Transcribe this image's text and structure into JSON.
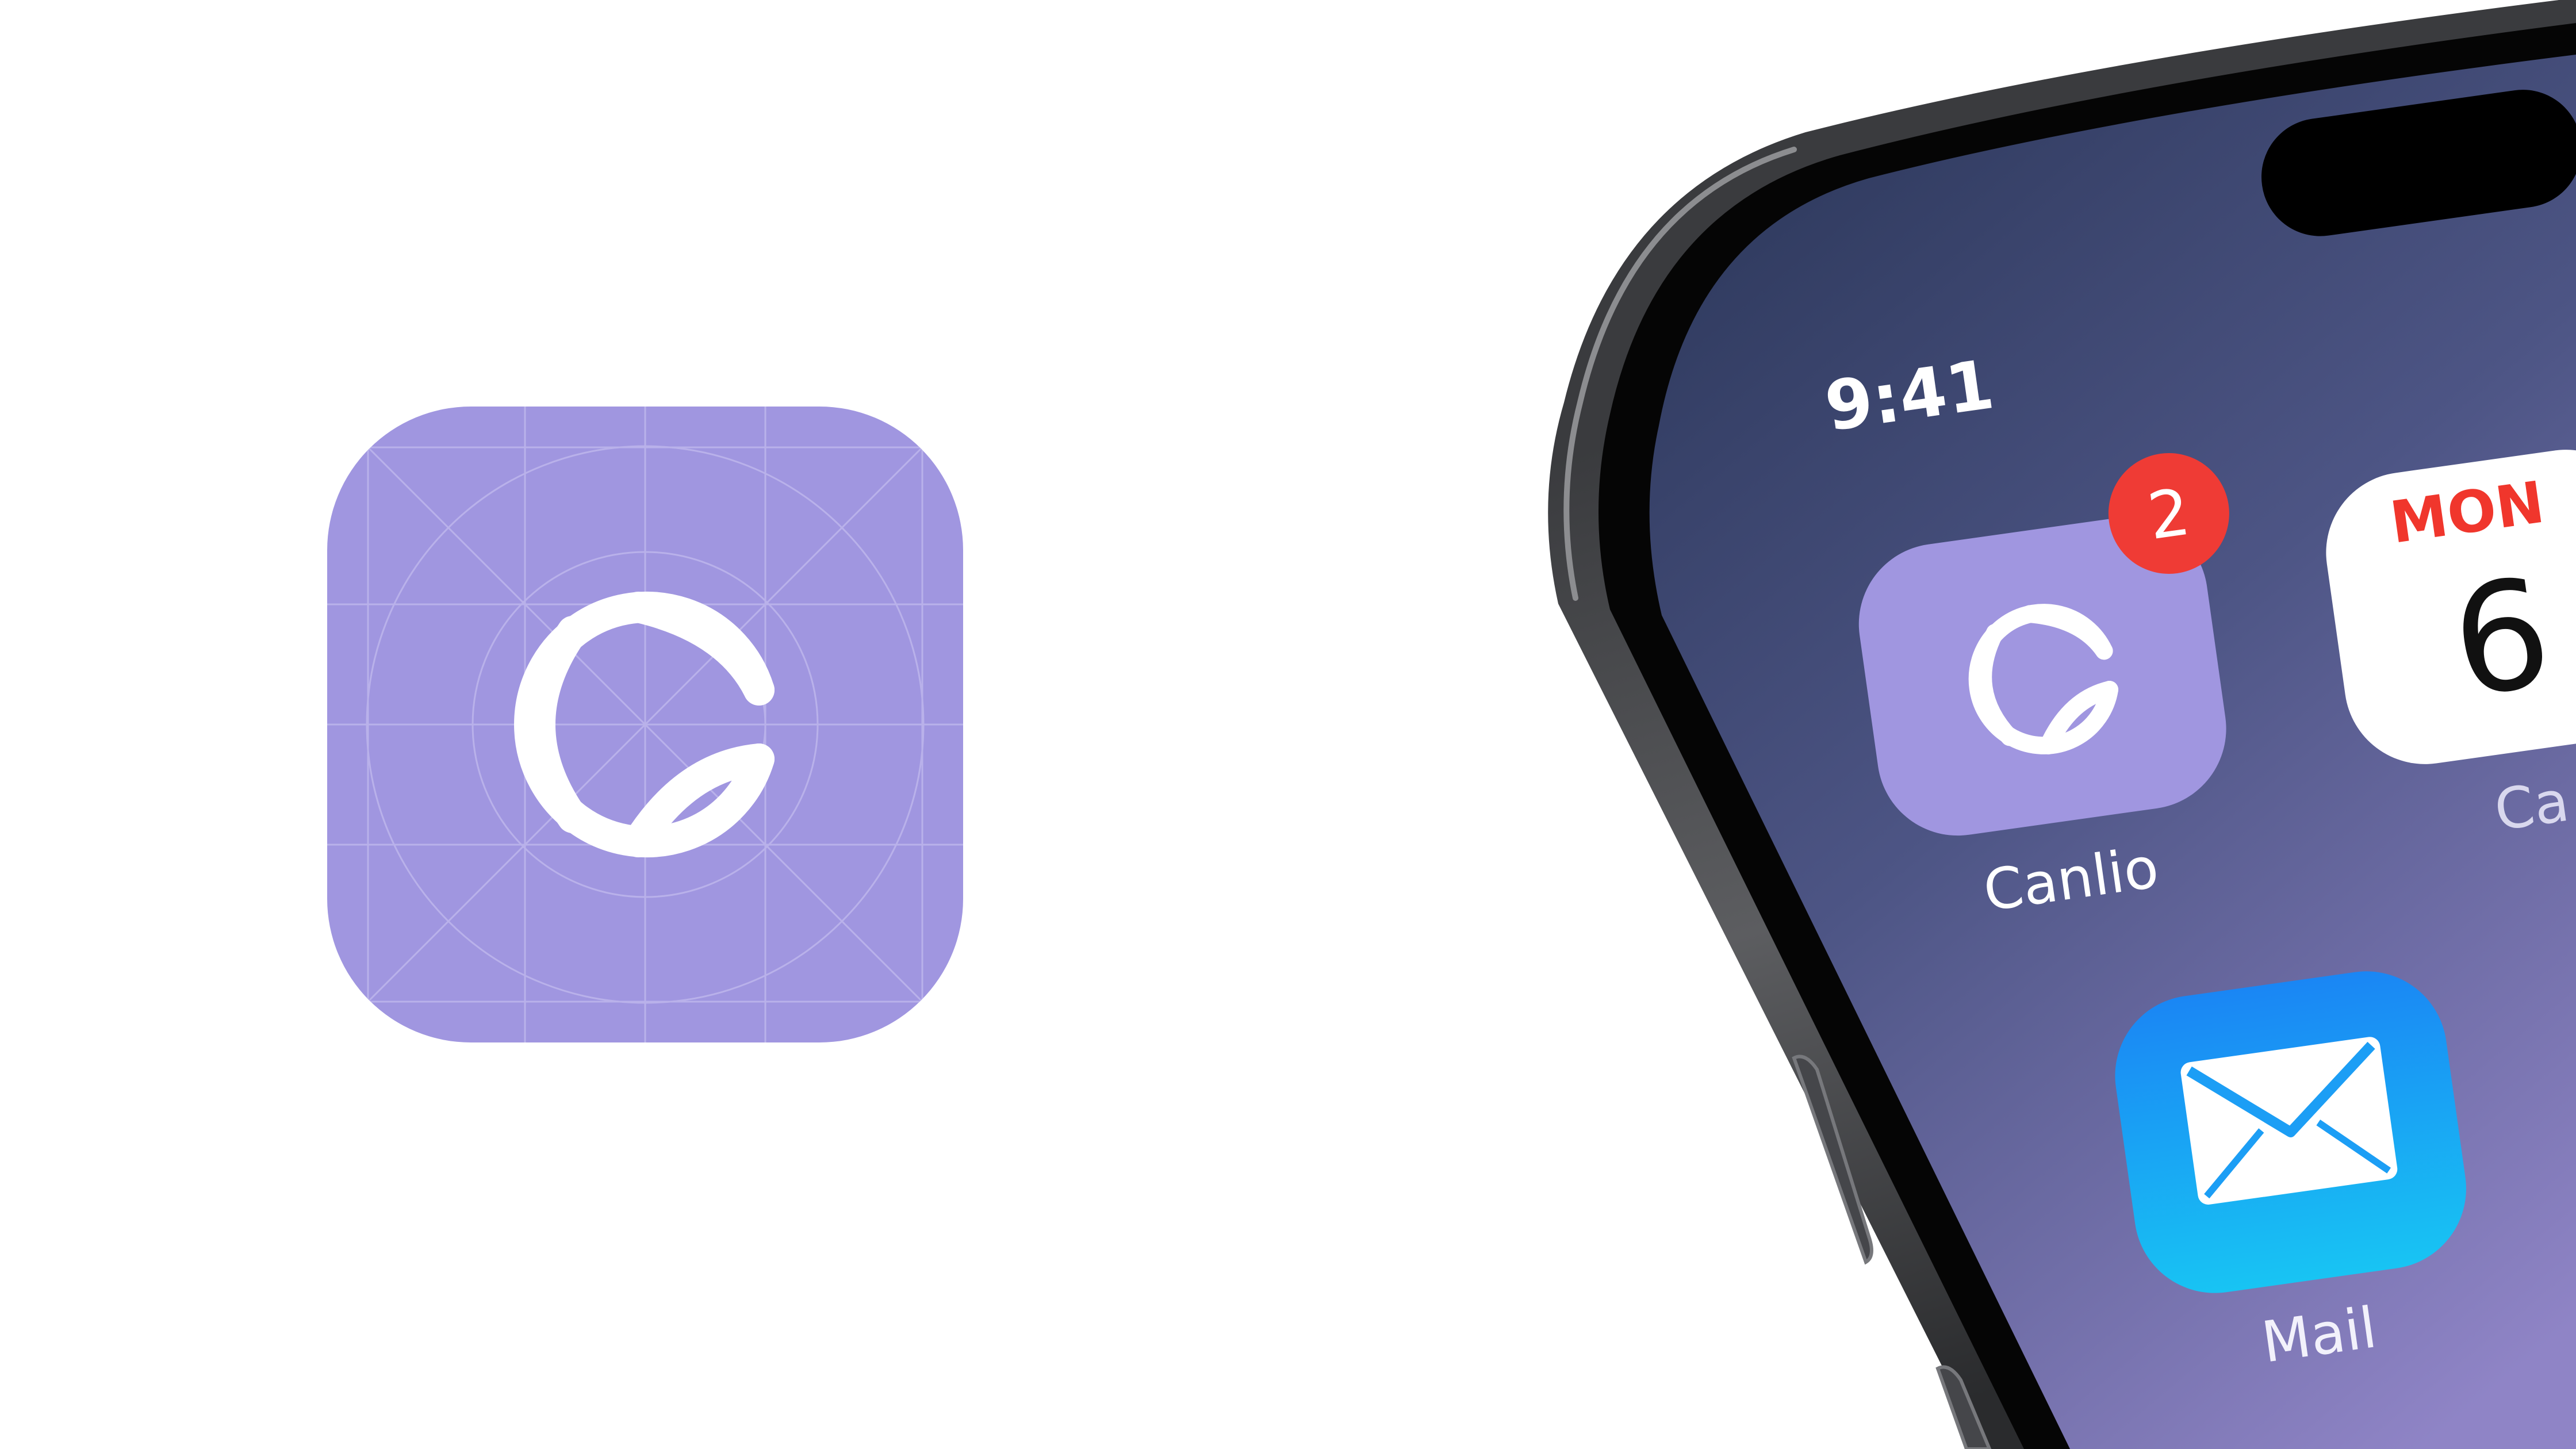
{
  "colors": {
    "background": "#ffffff",
    "icon_purple": "#a096e0",
    "icon_grid": "#b7afe9",
    "glyph": "#ffffff",
    "badge_red": "#ef3b35",
    "wallpaper_top": "#2f3a5e",
    "wallpaper_bottom": "#8c82c4",
    "mail_blue_top": "#1a8cf5",
    "mail_blue_bottom": "#17c0f2",
    "calendar_red": "#f0362c",
    "phone_frame": "#2b2c2e"
  },
  "status_bar": {
    "time": "9:41"
  },
  "apps": [
    {
      "label": "Canlio",
      "badge": "2",
      "icon": "canlio-logo-icon"
    },
    {
      "label": "Ca",
      "day": "MON",
      "date": "6",
      "icon": "calendar-icon"
    },
    {
      "label": "Mail",
      "icon": "mail-envelope-icon"
    }
  ]
}
